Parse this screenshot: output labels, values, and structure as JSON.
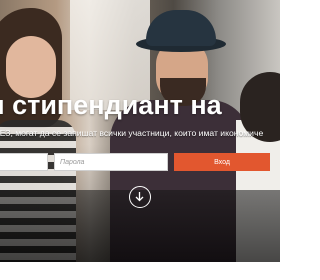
{
  "hero": {
    "headline": "и стипендиант на",
    "subtitle": "ЧЕЗ, могат да се запишат всички участници, които имат икономиче"
  },
  "login": {
    "username_placeholder": "",
    "password_placeholder": "Парола",
    "submit_label": "Вход"
  },
  "colors": {
    "accent": "#e2572f",
    "text_on_photo": "#ffffff"
  },
  "icons": {
    "scroll": "arrow-down-circle-icon"
  }
}
